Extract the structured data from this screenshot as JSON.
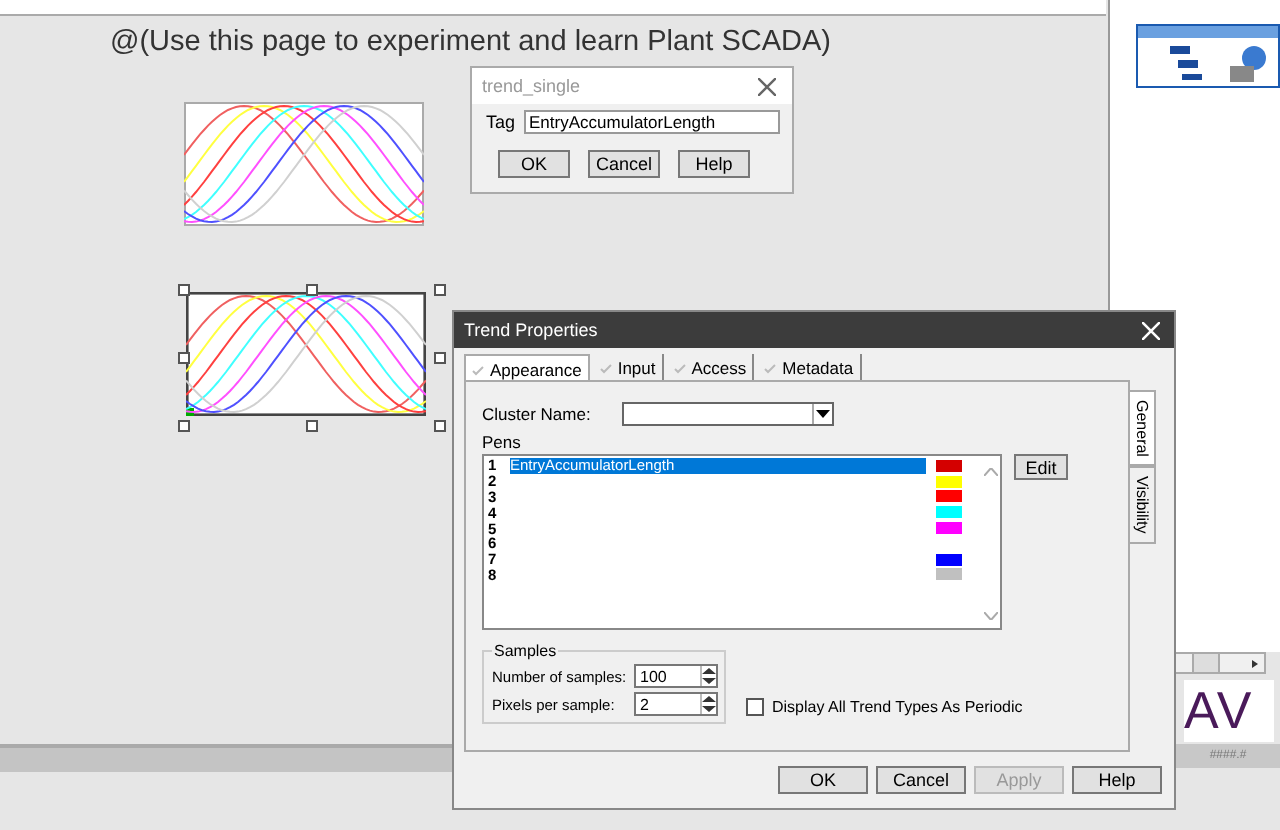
{
  "heading": "@(Use this page to experiment and learn Plant SCADA)",
  "trends": [
    {
      "selected": false
    },
    {
      "selected": true
    }
  ],
  "tag_dialog": {
    "title": "trend_single",
    "tag_label": "Tag",
    "tag_value": "EntryAccumulatorLength",
    "buttons": [
      "OK",
      "Cancel",
      "Help"
    ]
  },
  "properties_dialog": {
    "title": "Trend Properties",
    "tabs": [
      {
        "label": "Appearance",
        "selected": true
      },
      {
        "label": "Input",
        "selected": false
      },
      {
        "label": "Access",
        "selected": false
      },
      {
        "label": "Metadata",
        "selected": false
      }
    ],
    "side_tabs": [
      {
        "label": "General",
        "selected": true
      },
      {
        "label": "Visibility",
        "selected": false
      }
    ],
    "cluster_label": "Cluster Name:",
    "pens_label": "Pens",
    "pens": [
      {
        "number": "1",
        "name": "EntryAccumulatorLength",
        "color": "#d40000",
        "selected": true
      },
      {
        "number": "2",
        "color": "#ffff00",
        "selected": false
      },
      {
        "number": "3",
        "color": "#ff0000",
        "selected": false
      },
      {
        "number": "4",
        "color": "#00ffff",
        "selected": false
      },
      {
        "number": "5",
        "color": "#ff00ff",
        "selected": false
      },
      {
        "number": "6",
        "selected": false
      },
      {
        "number": "7",
        "color": "#0000ff",
        "selected": false
      },
      {
        "number": "8",
        "color": "#c0c0c0",
        "selected": false
      }
    ],
    "edit_button": "Edit",
    "samples": {
      "title": "Samples",
      "fields": [
        {
          "label": "Number of samples:",
          "value": "100"
        },
        {
          "label": "Pixels per sample:",
          "value": "2"
        }
      ]
    },
    "periodic": {
      "label": "Display All Trend Types As Periodic",
      "checked": false
    },
    "buttons": [
      {
        "label": "OK",
        "disabled": false
      },
      {
        "label": "Cancel",
        "disabled": false
      },
      {
        "label": "Apply",
        "disabled": true
      },
      {
        "label": "Help",
        "disabled": false
      }
    ]
  },
  "logo": "AV",
  "status_text": "####.#"
}
